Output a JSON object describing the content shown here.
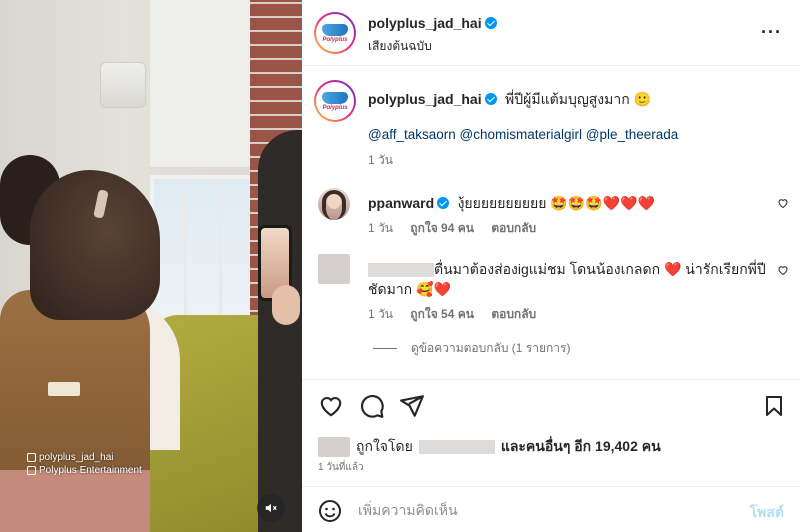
{
  "post": {
    "author": "polyplus_jad_hai",
    "audio": "เสียงต้นฉบับ",
    "logo_text": "Polyplus",
    "watermark": {
      "line1": "polyplus_jad_hai",
      "line2": "Polyplus Entertainment"
    }
  },
  "caption": {
    "username": "polyplus_jad_hai",
    "text": "พี่ปีผู้มีแต้มบุญสูงมาก 🙂",
    "mentions": "@aff_taksaorn @chomismaterialgirl @ple_theerada",
    "time": "1 วัน"
  },
  "comments": [
    {
      "username": "ppanward",
      "text": "งุ้ยยยยยยยยยย 🤩🤩🤩❤️❤️❤️",
      "time": "1 วัน",
      "likes": "ถูกใจ 94 คน",
      "reply": "ตอบกลับ"
    },
    {
      "username": "",
      "text_line1": "ตื่นมาต้องส่องigแม่ชม โดนน้องเกลดก ❤️ น่ารักเรียกพี่ปี",
      "text_line2": "ชัดมาก 🥰❤️",
      "time": "1 วัน",
      "likes": "ถูกใจ 54 คน",
      "reply": "ตอบกลับ",
      "view_replies": "ดูข้อความตอบกลับ (1 รายการ)"
    }
  ],
  "likes": {
    "prefix": "ถูกใจโดย",
    "suffix": "และคนอื่นๆ อีก 19,402 คน",
    "time": "1 วันที่แล้ว"
  },
  "composer": {
    "placeholder": "เพิ่มความคิดเห็น",
    "post_label": "โพสต์"
  },
  "icons": {
    "more": "more-options-icon",
    "like": "heart-icon",
    "comment": "comment-icon",
    "share": "paper-plane-icon",
    "save": "bookmark-icon",
    "emoji": "smiley-icon",
    "mute": "speaker-muted-icon"
  },
  "colors": {
    "verified": "#0095f6",
    "mention": "#00376b",
    "post_button": "#b2dffc",
    "muted_text": "#737373"
  }
}
